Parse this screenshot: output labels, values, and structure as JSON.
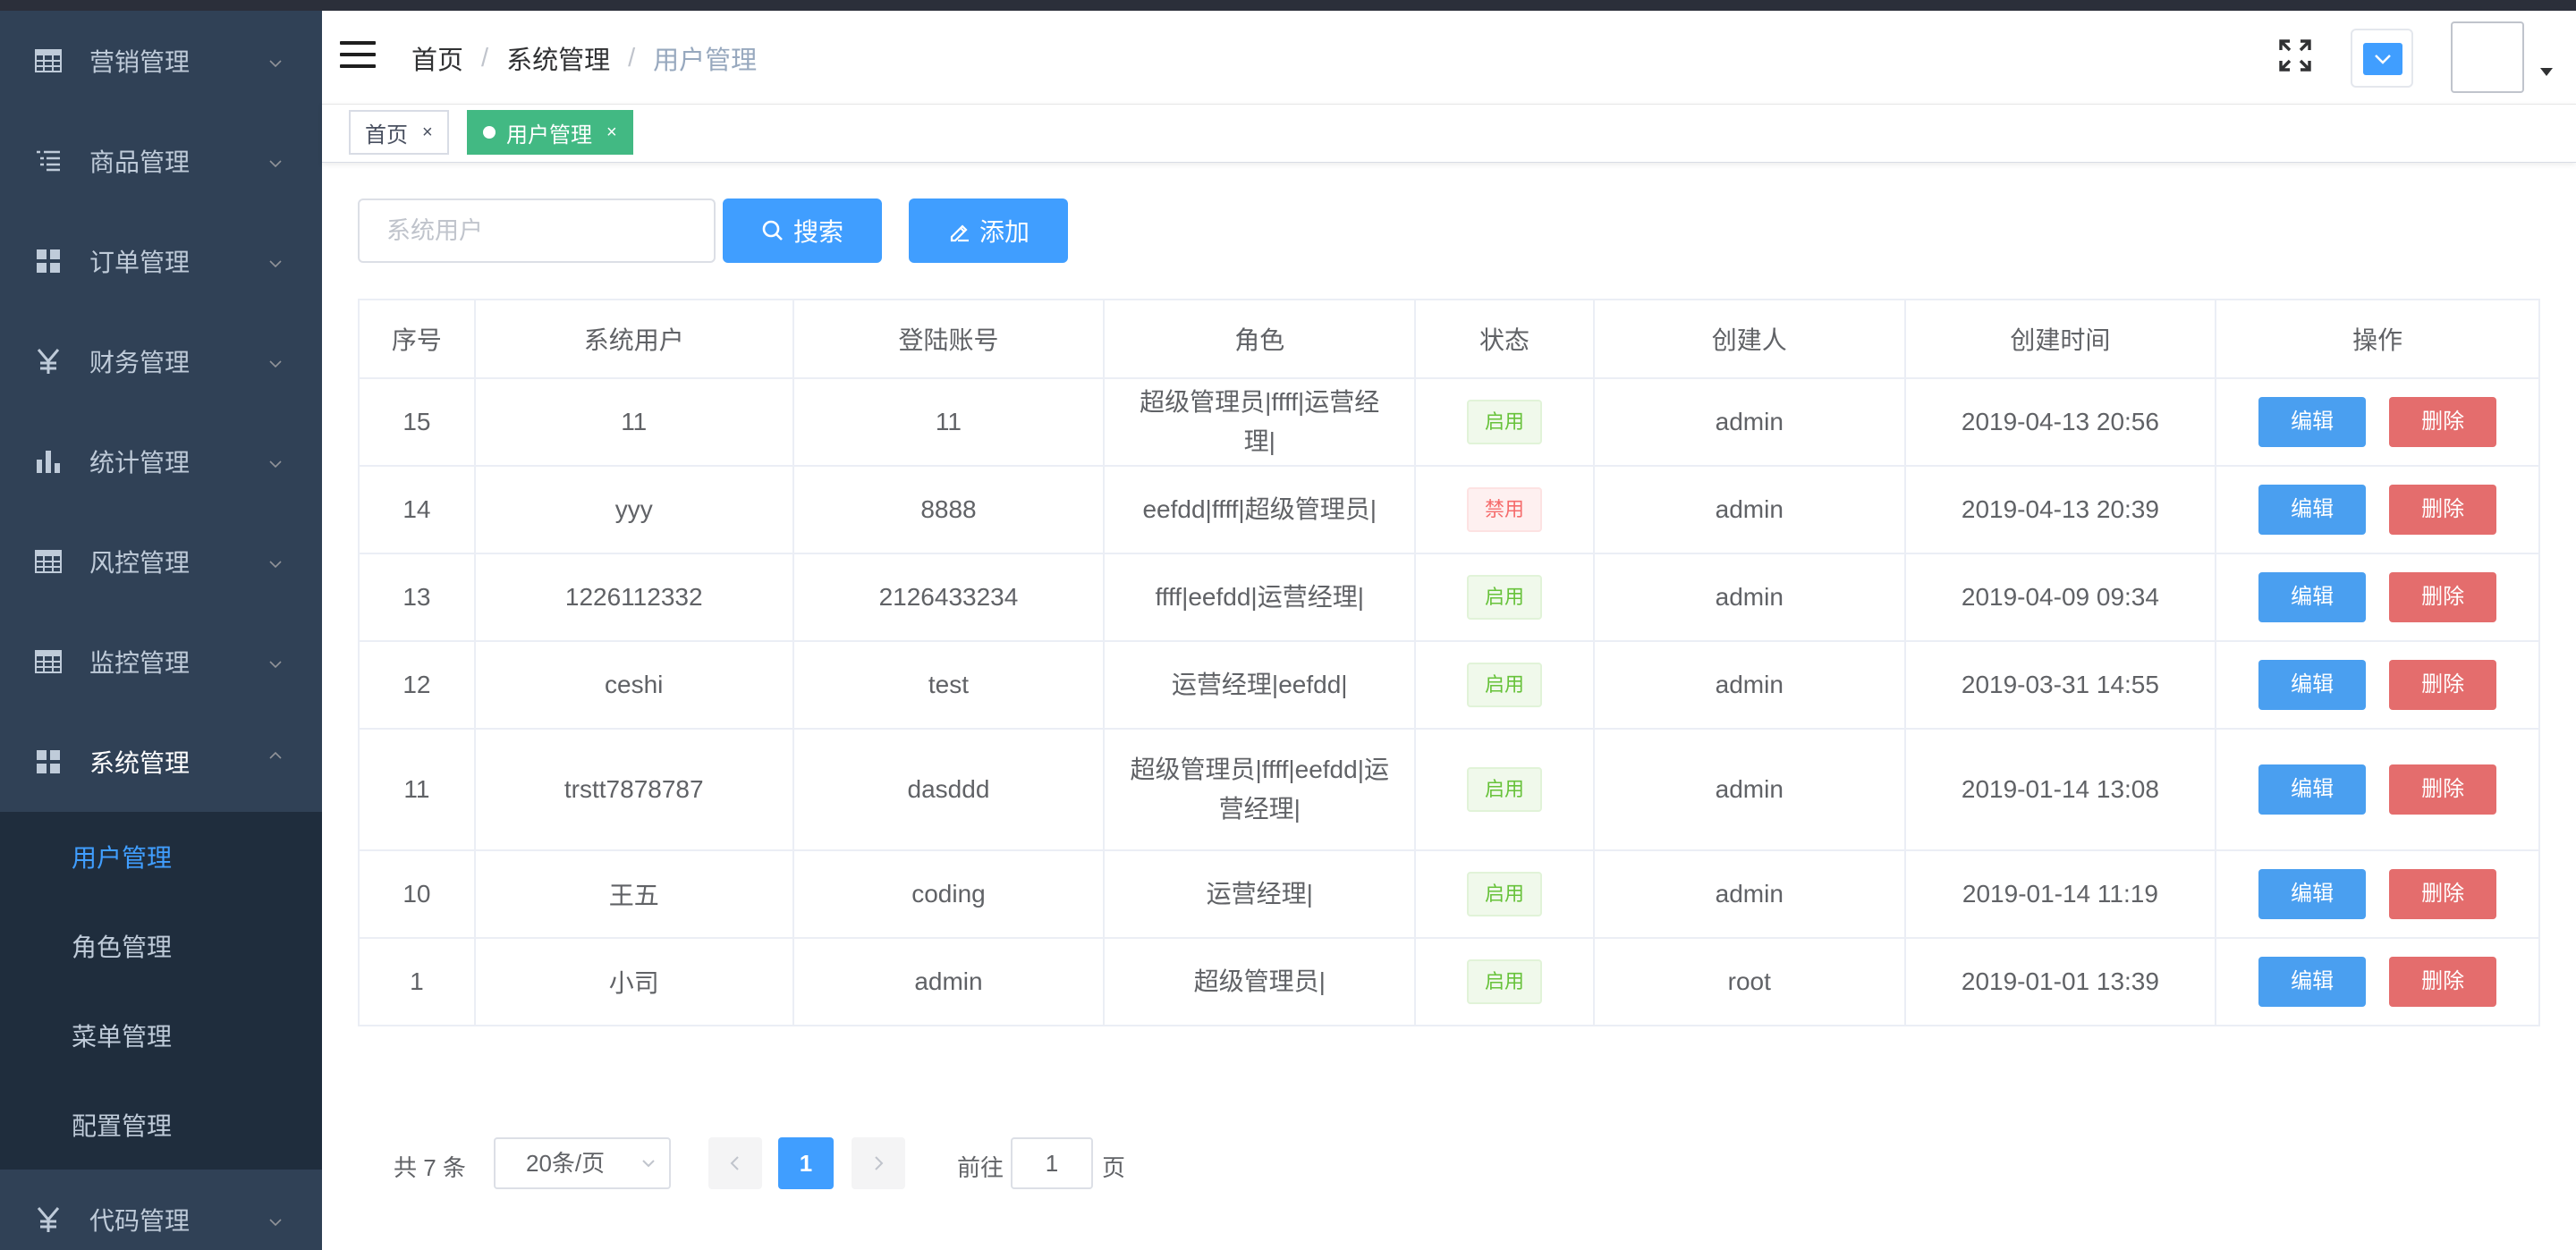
{
  "sidebar": {
    "menus": [
      {
        "label": "营销管理",
        "icon": "grid-table-icon"
      },
      {
        "label": "商品管理",
        "icon": "list-icon"
      },
      {
        "label": "订单管理",
        "icon": "dashboard-icon"
      },
      {
        "label": "财务管理",
        "icon": "yen-icon"
      },
      {
        "label": "统计管理",
        "icon": "bar-chart-icon"
      },
      {
        "label": "风控管理",
        "icon": "grid-table-icon"
      },
      {
        "label": "监控管理",
        "icon": "grid-table-icon"
      },
      {
        "label": "系统管理",
        "icon": "dashboard-icon"
      }
    ],
    "submenu": [
      "用户管理",
      "角色管理",
      "菜单管理",
      "配置管理"
    ],
    "last_menu": {
      "label": "代码管理",
      "icon": "yen-icon"
    }
  },
  "header": {
    "breadcrumb": [
      "首页",
      "系统管理",
      "用户管理"
    ]
  },
  "tags": {
    "home": "首页",
    "current": "用户管理",
    "close": "×"
  },
  "toolbar": {
    "search_placeholder": "系统用户",
    "search_label": "搜索",
    "add_label": "添加"
  },
  "table": {
    "columns": [
      "序号",
      "系统用户",
      "登陆账号",
      "角色",
      "状态",
      "创建人",
      "创建时间",
      "操作"
    ],
    "rows": [
      {
        "id": "15",
        "user": "11",
        "account": "11",
        "role": "超级管理员|ffff|运营经理|",
        "status": "启用",
        "creator": "admin",
        "created": "2019-04-13 20:56"
      },
      {
        "id": "14",
        "user": "yyy",
        "account": "8888",
        "role": "eefdd|ffff|超级管理员|",
        "status": "禁用",
        "creator": "admin",
        "created": "2019-04-13 20:39"
      },
      {
        "id": "13",
        "user": "1226112332",
        "account": "2126433234",
        "role": "ffff|eefdd|运营经理|",
        "status": "启用",
        "creator": "admin",
        "created": "2019-04-09 09:34"
      },
      {
        "id": "12",
        "user": "ceshi",
        "account": "test",
        "role": "运营经理|eefdd|",
        "status": "启用",
        "creator": "admin",
        "created": "2019-03-31 14:55"
      },
      {
        "id": "11",
        "user": "trstt7878787",
        "account": "dasddd",
        "role": "超级管理员|ffff|eefdd|运营经理|",
        "status": "启用",
        "creator": "admin",
        "created": "2019-01-14 13:08"
      },
      {
        "id": "10",
        "user": "王五",
        "account": "coding",
        "role": "运营经理|",
        "status": "启用",
        "creator": "admin",
        "created": "2019-01-14 11:19"
      },
      {
        "id": "1",
        "user": "小司",
        "account": "admin",
        "role": "超级管理员|",
        "status": "启用",
        "creator": "root",
        "created": "2019-01-01 13:39"
      }
    ],
    "edit_label": "编辑",
    "delete_label": "删除"
  },
  "pagination": {
    "total": "共 7 条",
    "page_size": "20条/页",
    "current_page": "1",
    "goto_prefix": "前往",
    "goto_value": "1",
    "goto_suffix": "页"
  },
  "colors": {
    "sidebar_bg": "#304156",
    "submenu_bg": "#1f2d3d",
    "accent": "#409eff",
    "tag_active": "#42b983",
    "danger": "#e46d6d"
  }
}
